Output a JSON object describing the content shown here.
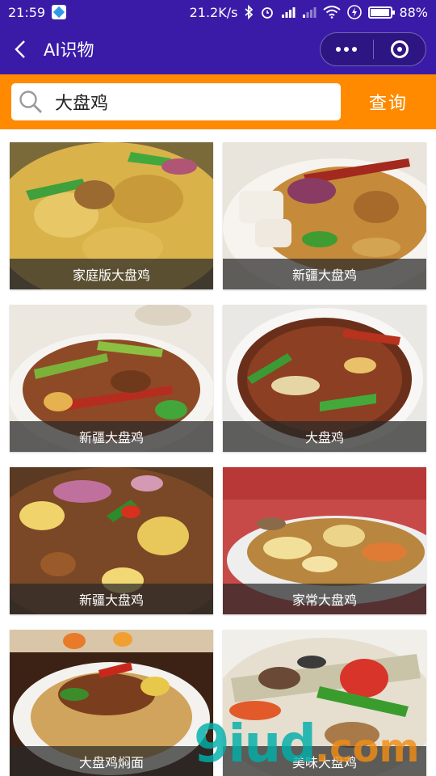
{
  "status_bar": {
    "time": "21:59",
    "network_speed": "21.2K/s",
    "battery_percent": "88%",
    "icons": [
      "app-notification-icon",
      "bluetooth-icon",
      "alarm-icon",
      "signal-icon",
      "signal-2-icon",
      "wifi-icon",
      "charging-icon",
      "battery-icon"
    ]
  },
  "nav": {
    "title": "AI识物"
  },
  "search": {
    "value": "大盘鸡",
    "button_label": "查询"
  },
  "results": [
    {
      "label": "家庭版大盘鸡"
    },
    {
      "label": "新疆大盘鸡"
    },
    {
      "label": "新疆大盘鸡"
    },
    {
      "label": "大盘鸡"
    },
    {
      "label": "新疆大盘鸡"
    },
    {
      "label": "家常大盘鸡"
    },
    {
      "label": "大盘鸡焖面"
    },
    {
      "label": "美味大盘鸡"
    }
  ],
  "watermark": {
    "text": "9iud",
    "suffix": ".com"
  },
  "colors": {
    "header": "#3a1ba8",
    "search_bar": "#ff8a00"
  }
}
